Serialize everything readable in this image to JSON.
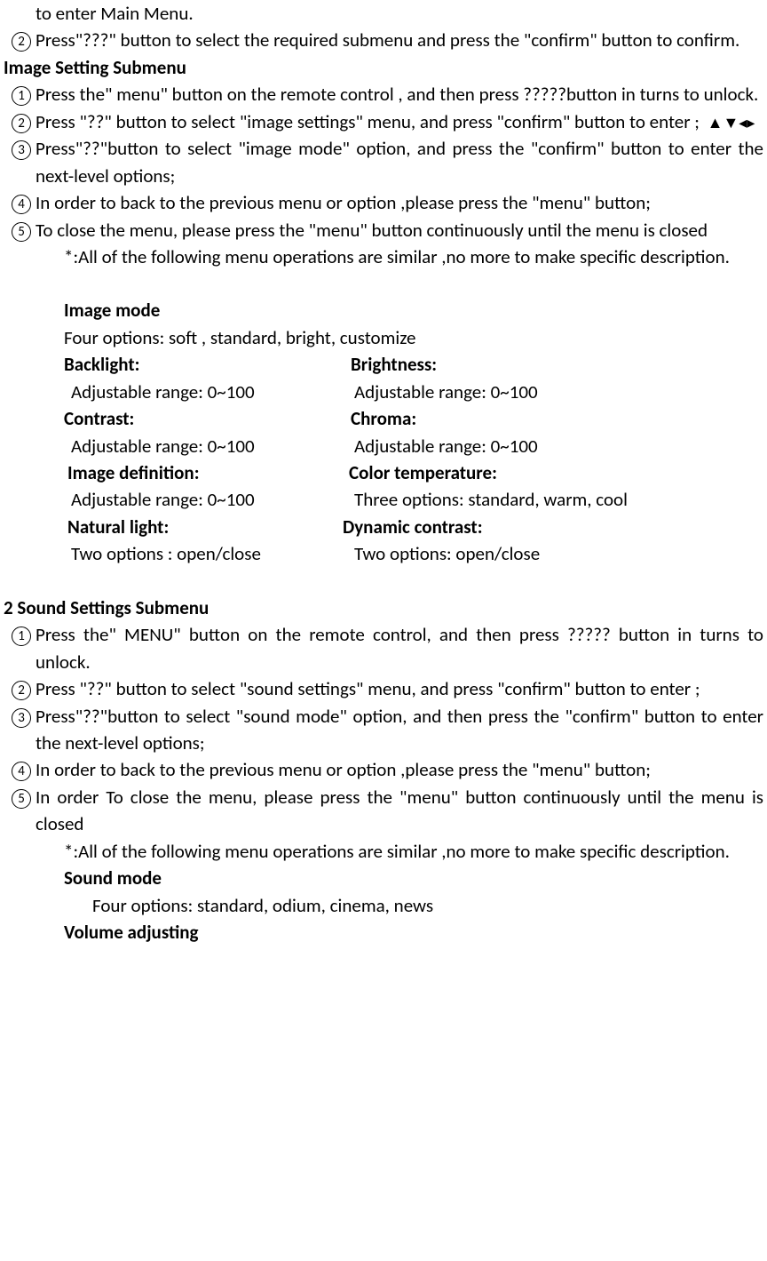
{
  "top": {
    "line1": "to enter Main Menu.",
    "item2_num": "2",
    "item2_text": "Press\"???\" button to select the required submenu and press the \"confirm\" button to confirm."
  },
  "imageSetting": {
    "title": "Image Setting Submenu",
    "items": [
      {
        "num": "1",
        "text": "Press the\" menu\" button on the remote control , and then press ?????button in turns to unlock."
      },
      {
        "num": "2",
        "text_pre": "Press \"??\" button to select \"image settings\" menu, and press \"confirm\" button to enter ;",
        "arrows": "▲▼◂▸"
      },
      {
        "num": "3",
        "text": "Press\"??\"button to select \"image mode\" option, and press the \"confirm\" button to enter the next-level options;"
      },
      {
        "num": "4",
        "text": "In order to back to the previous menu or option ,please press the \"menu\" button;"
      },
      {
        "num": "5",
        "text": "To close the menu, please press the \"menu\" button continuously until the menu is closed"
      }
    ],
    "note": "*:All of the following menu operations are similar ,no more to make specific description.",
    "imageMode": {
      "title": "Image mode",
      "line": "Four options: soft , standard, bright, customize"
    },
    "params": [
      {
        "l_label": "Backlight:",
        "r_label": "Brightness:",
        "l_val": "Adjustable range: 0~100",
        "r_val": "Adjustable range: 0~100"
      },
      {
        "l_label": "Contrast:",
        "r_label": "Chroma:",
        "l_val": "Adjustable range: 0~100",
        "r_val": "Adjustable range: 0~100"
      },
      {
        "l_label": "Image definition:",
        "r_label": "Color temperature:",
        "l_val": "Adjustable range: 0~100",
        "r_val": "Three options: standard, warm, cool"
      },
      {
        "l_label": "Natural light:",
        "r_label": "Dynamic contrast:",
        "l_val": "Two options : open/close",
        "r_val": "Two options: open/close"
      }
    ]
  },
  "soundSetting": {
    "title": "2 Sound Settings Submenu",
    "items": [
      {
        "num": "1",
        "text": "Press the\" MENU\" button on the remote control, and then press ????? button in turns to unlock."
      },
      {
        "num": "2",
        "text": "Press \"??\" button to select \"sound settings\" menu, and press \"confirm\" button to enter ;"
      },
      {
        "num": "3",
        "text": "Press\"??\"button to select \"sound mode\" option, and then press the \"confirm\" button to enter the next-level options;"
      },
      {
        "num": "4",
        "text": "In order to back to the previous menu or option ,please press the \"menu\" button;"
      },
      {
        "num": "5",
        "text": "In order To close the menu, please press the \"menu\" button continuously until the menu is closed"
      }
    ],
    "note": "*:All of the following menu operations are similar ,no more to make specific description.",
    "soundMode": {
      "title": "Sound mode",
      "line": "Four options: standard, odium, cinema, news"
    },
    "volume": {
      "title": "Volume adjusting"
    }
  }
}
